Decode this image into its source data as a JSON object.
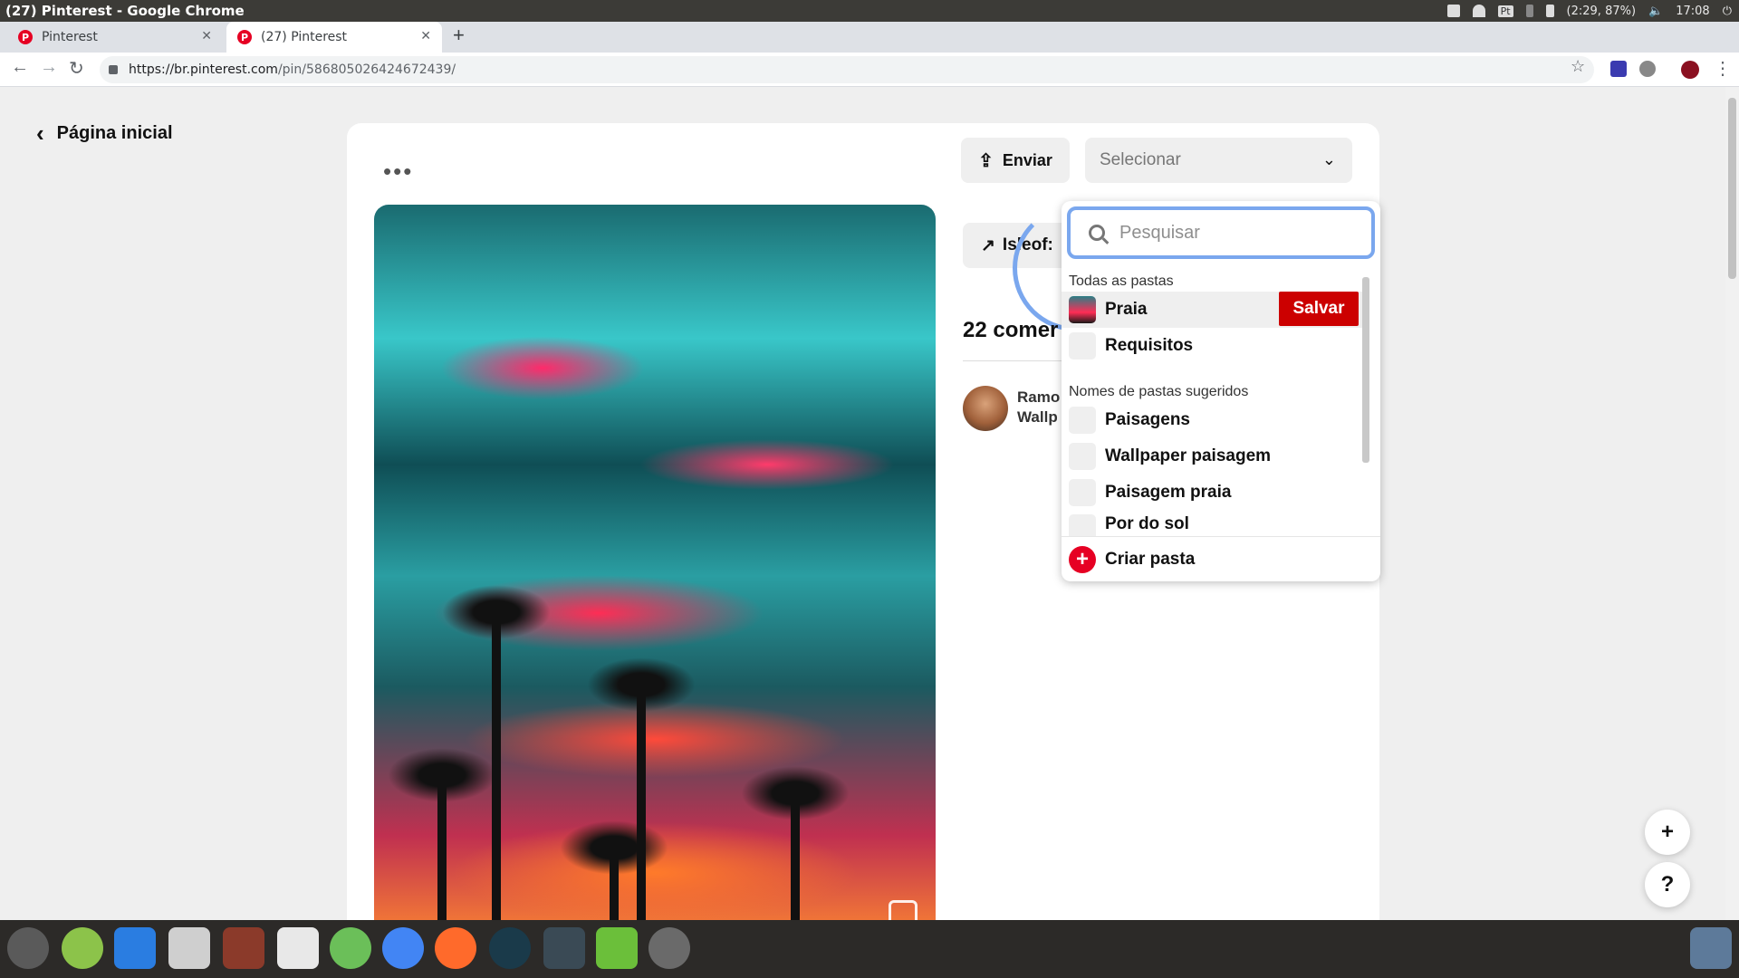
{
  "os": {
    "window_title": "(27) Pinterest - Google Chrome",
    "battery": "(2:29, 87%)",
    "clock": "17:08",
    "keyboard": "Pt"
  },
  "browser": {
    "tabs": [
      {
        "label": "Pinterest"
      },
      {
        "label": "(27) Pinterest"
      }
    ],
    "url_host": "https://br.pinterest.com",
    "url_path": "/pin/586805026424672439/"
  },
  "page": {
    "back_label": "Página inicial",
    "enviar_label": "Enviar",
    "select_placeholder": "Selecionar",
    "visit_label": "Isleof:",
    "comments_label": "22 comer",
    "commenter_line1": "Ramo",
    "commenter_line2": "Wallp"
  },
  "dropdown": {
    "search_placeholder": "Pesquisar",
    "section_all": "Todas as pastas",
    "section_suggested": "Nomes de pastas sugeridos",
    "boards": [
      "Praia",
      "Requisitos"
    ],
    "suggested": [
      "Paisagens",
      "Wallpaper paisagem",
      "Paisagem praia",
      "Por do sol"
    ],
    "save_label": "Salvar",
    "create_label": "Criar pasta"
  },
  "fabs": {
    "plus": "+",
    "help": "?"
  },
  "colors": {
    "pinterest_red": "#e60023",
    "save_red": "#cc0000",
    "focus_blue": "#7aa7ee"
  }
}
